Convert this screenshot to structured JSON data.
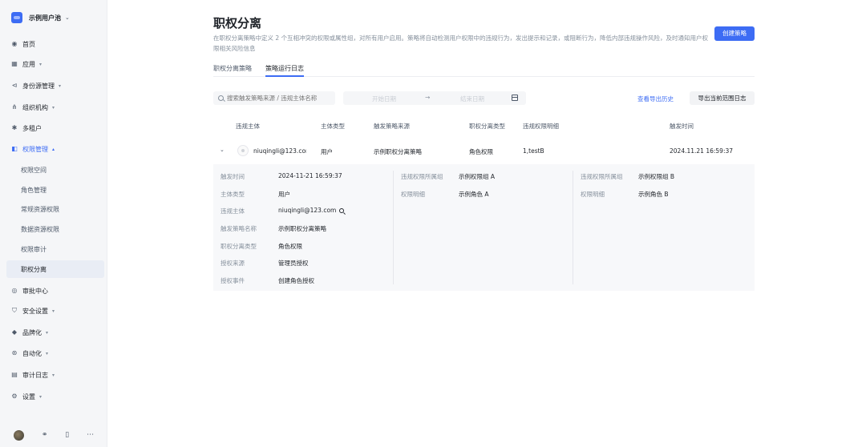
{
  "sidebar": {
    "brand": "示例用户池",
    "items": [
      {
        "label": "首页",
        "icon": "home-icon"
      },
      {
        "label": "应用",
        "icon": "grid-icon",
        "caret": true
      },
      {
        "label": "身份源管理",
        "icon": "share-icon",
        "caret": true
      },
      {
        "label": "组织机构",
        "icon": "org-icon",
        "caret": true
      },
      {
        "label": "多租户",
        "icon": "tenant-icon"
      },
      {
        "label": "权限管理",
        "icon": "permission-icon",
        "caret": true,
        "open": true
      },
      {
        "label": "权限空间",
        "sub": true
      },
      {
        "label": "角色管理",
        "sub": true
      },
      {
        "label": "常规资源权限",
        "sub": true
      },
      {
        "label": "数据资源权限",
        "sub": true
      },
      {
        "label": "权限审计",
        "sub": true
      },
      {
        "label": "职权分离",
        "sub": true,
        "active": true
      },
      {
        "label": "审批中心",
        "icon": "approval-icon"
      },
      {
        "label": "安全设置",
        "icon": "security-icon",
        "caret": true
      },
      {
        "label": "品牌化",
        "icon": "brand-icon",
        "caret": true
      },
      {
        "label": "自动化",
        "icon": "automation-icon",
        "caret": true
      },
      {
        "label": "审计日志",
        "icon": "audit-log-icon",
        "caret": true
      },
      {
        "label": "设置",
        "icon": "settings-icon",
        "caret": true
      }
    ]
  },
  "header": {
    "title": "职权分离",
    "description": "在职权分离策略中定义 2 个互相冲突的权限或属性组，对所有用户启用。策略将自动检测用户权限中的违规行为，发出提示和记录，或阻断行为，降低内部违规操作风险，及时通知用户权限相关风险信息",
    "create_button": "创建策略"
  },
  "tabs": [
    {
      "label": "职权分离策略",
      "active": false
    },
    {
      "label": "策略运行日志",
      "active": true
    }
  ],
  "toolbar": {
    "search_placeholder": "搜索触发策略来源 / 违规主体名称",
    "start_date_placeholder": "开始日期",
    "date_separator": "→",
    "end_date_placeholder": "结束日期",
    "history_link": "查看导出历史",
    "export_button": "导出当前范围日志"
  },
  "table": {
    "columns": [
      "违规主体",
      "主体类型",
      "触发策略来源",
      "职权分离类型",
      "违规权限明细",
      "触发时间"
    ],
    "rows": [
      {
        "subject": "niuqingli@123.com",
        "subject_type": "用户",
        "policy_source": "示例职权分离策略",
        "sod_type": "角色权限",
        "detail": "1,testB",
        "time": "2024.11.21 16:59:37"
      }
    ]
  },
  "detail": {
    "left": [
      {
        "label": "触发时间",
        "value": "2024-11-21 16:59:37"
      },
      {
        "label": "主体类型",
        "value": "用户"
      },
      {
        "label": "违规主体",
        "value": "niuqingli@123.com"
      },
      {
        "label": "触发策略名称",
        "value": "示例职权分离策略"
      },
      {
        "label": "职权分离类型",
        "value": "角色权限"
      },
      {
        "label": "授权来源",
        "value": "管理员授权"
      },
      {
        "label": "授权事件",
        "value": "创建角色授权"
      }
    ],
    "middle": [
      {
        "label": "违规权限所属组",
        "value": "示例权限组 A"
      },
      {
        "label": "权限明细",
        "value": "示例角色 A"
      }
    ],
    "right": [
      {
        "label": "违规权限所属组",
        "value": "示例权限组 B"
      },
      {
        "label": "权限明细",
        "value": "示例角色 B"
      }
    ]
  },
  "colors": {
    "accent": "#3d6cf4",
    "sidebar_bg": "#f5f6f8",
    "detail_bg": "#f7f8fa"
  }
}
